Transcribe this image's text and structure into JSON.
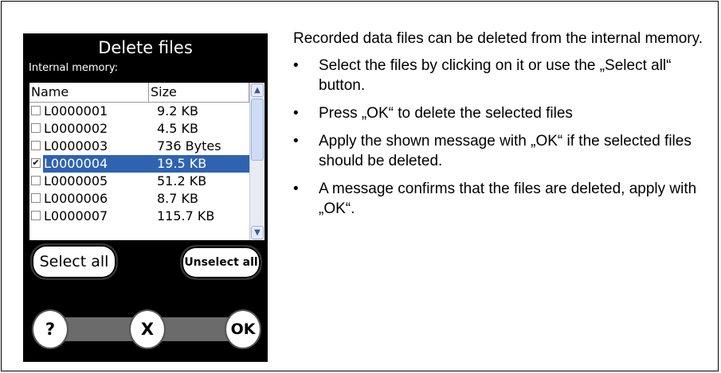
{
  "device": {
    "title": "Delete files",
    "subtitle": "Internal memory:",
    "columns": {
      "name": "Name",
      "size": "Size"
    },
    "files": [
      {
        "name": "L0000001",
        "size": "9.2 KB",
        "checked": false
      },
      {
        "name": "L0000002",
        "size": "4.5 KB",
        "checked": false
      },
      {
        "name": "L0000003",
        "size": "736 Bytes",
        "checked": false
      },
      {
        "name": "L0000004",
        "size": "19.5 KB",
        "checked": true
      },
      {
        "name": "L0000005",
        "size": "51.2 KB",
        "checked": false
      },
      {
        "name": "L0000006",
        "size": "8.7 KB",
        "checked": false
      },
      {
        "name": "L0000007",
        "size": "115.7 KB",
        "checked": false
      }
    ],
    "select_all_label": "Select all",
    "unselect_all_label": "Unselect all",
    "help_label": "?",
    "cancel_label": "X",
    "ok_label": "OK"
  },
  "instructions": {
    "intro": "Recorded data files can be deleted from the internal memory.",
    "bullets": [
      "Select the files by clicking on it or use the „Select all“ button.",
      "Press „OK“ to delete the selected files",
      "Apply the shown message with „OK“ if the selected files should be deleted.",
      "A message confirms that the files are deleted, apply with „OK“."
    ],
    "bullet_char": "•"
  },
  "colors": {
    "selection": "#2f63b0",
    "device_bg": "#000000"
  }
}
